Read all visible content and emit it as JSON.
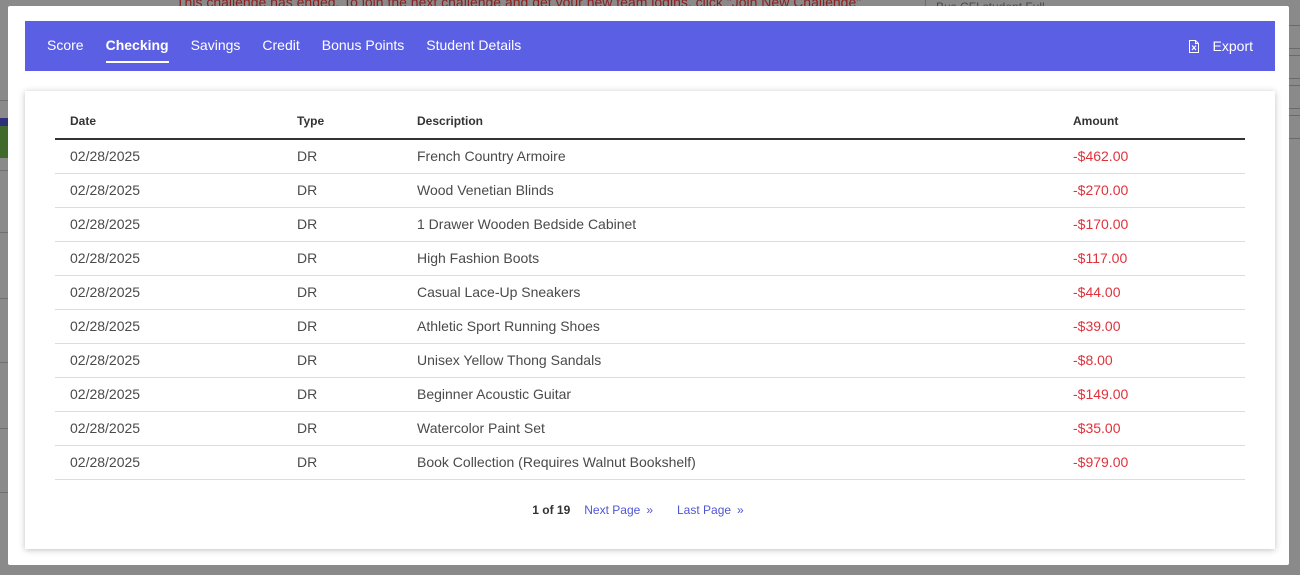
{
  "background": {
    "banner": "This challenge has ended. To join the next challenge and get your new team logins, click \"Join New Challenge\"",
    "right_panel": "Bus CFI student Full"
  },
  "tabs": [
    {
      "label": "Score",
      "active": false
    },
    {
      "label": "Checking",
      "active": true
    },
    {
      "label": "Savings",
      "active": false
    },
    {
      "label": "Credit",
      "active": false
    },
    {
      "label": "Bonus Points",
      "active": false
    },
    {
      "label": "Student Details",
      "active": false
    }
  ],
  "export": {
    "label": "Export",
    "icon": "file-excel-icon"
  },
  "table": {
    "headers": {
      "date": "Date",
      "type": "Type",
      "description": "Description",
      "amount": "Amount"
    },
    "rows": [
      {
        "date": "02/28/2025",
        "type": "DR",
        "description": "French Country Armoire",
        "amount": "-$462.00"
      },
      {
        "date": "02/28/2025",
        "type": "DR",
        "description": "Wood Venetian Blinds",
        "amount": "-$270.00"
      },
      {
        "date": "02/28/2025",
        "type": "DR",
        "description": "1 Drawer Wooden Bedside Cabinet",
        "amount": "-$170.00"
      },
      {
        "date": "02/28/2025",
        "type": "DR",
        "description": "High Fashion Boots",
        "amount": "-$117.00"
      },
      {
        "date": "02/28/2025",
        "type": "DR",
        "description": "Casual Lace-Up Sneakers",
        "amount": "-$44.00"
      },
      {
        "date": "02/28/2025",
        "type": "DR",
        "description": "Athletic Sport Running Shoes",
        "amount": "-$39.00"
      },
      {
        "date": "02/28/2025",
        "type": "DR",
        "description": "Unisex Yellow Thong Sandals",
        "amount": "-$8.00"
      },
      {
        "date": "02/28/2025",
        "type": "DR",
        "description": "Beginner Acoustic Guitar",
        "amount": "-$149.00"
      },
      {
        "date": "02/28/2025",
        "type": "DR",
        "description": "Watercolor Paint Set",
        "amount": "-$35.00"
      },
      {
        "date": "02/28/2025",
        "type": "DR",
        "description": "Book Collection (Requires Walnut Bookshelf)",
        "amount": "-$979.00"
      }
    ]
  },
  "pagination": {
    "page_info": "1 of 19",
    "next_label": "Next Page",
    "last_label": "Last Page",
    "arrow": "»"
  },
  "colors": {
    "tabbar": "#5b5fe3",
    "negative_amount": "#e0323b",
    "link": "#4f56d6"
  }
}
